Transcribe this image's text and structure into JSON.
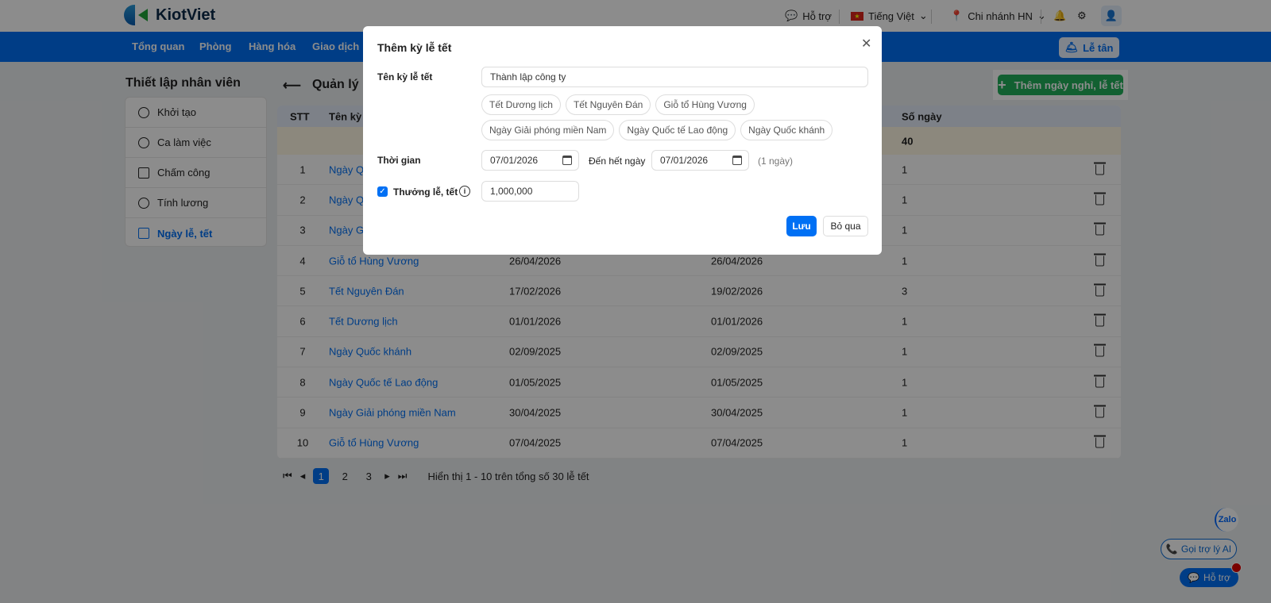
{
  "header": {
    "brand": "KiotViet",
    "support": "Hỗ trợ",
    "language": "Tiếng Việt",
    "branch": "Chi nhánh HN"
  },
  "nav": {
    "items": [
      "Tổng quan",
      "Phòng",
      "Hàng hóa",
      "Giao dịch"
    ],
    "reception": "Lễ tân"
  },
  "sidebar": {
    "title": "Thiết lập nhân viên",
    "items": [
      {
        "label": "Khởi tạo"
      },
      {
        "label": "Ca làm việc"
      },
      {
        "label": "Chấm công"
      },
      {
        "label": "Tính lương"
      },
      {
        "label": "Ngày lễ, tết"
      }
    ]
  },
  "main": {
    "title": "Quản lý Lễ",
    "add_button": "Thêm ngày nghỉ, lễ tết",
    "columns": {
      "stt": "STT",
      "name": "Tên kỳ lễ",
      "days": "Số ngày"
    },
    "total_days": "40",
    "rows": [
      {
        "stt": "1",
        "name": "Ngày Qu",
        "from": "",
        "to": "",
        "days": "1"
      },
      {
        "stt": "2",
        "name": "Ngày Qu",
        "from": "",
        "to": "",
        "days": "1"
      },
      {
        "stt": "3",
        "name": "Ngày Gi",
        "from": "",
        "to": "",
        "days": "1"
      },
      {
        "stt": "4",
        "name": "Giỗ tổ Hùng Vương",
        "from": "26/04/2026",
        "to": "26/04/2026",
        "days": "1"
      },
      {
        "stt": "5",
        "name": "Tết Nguyên Đán",
        "from": "17/02/2026",
        "to": "19/02/2026",
        "days": "3"
      },
      {
        "stt": "6",
        "name": "Tết Dương lịch",
        "from": "01/01/2026",
        "to": "01/01/2026",
        "days": "1"
      },
      {
        "stt": "7",
        "name": "Ngày Quốc khánh",
        "from": "02/09/2025",
        "to": "02/09/2025",
        "days": "1"
      },
      {
        "stt": "8",
        "name": "Ngày Quốc tế Lao động",
        "from": "01/05/2025",
        "to": "01/05/2025",
        "days": "1"
      },
      {
        "stt": "9",
        "name": "Ngày Giải phóng miền Nam",
        "from": "30/04/2025",
        "to": "30/04/2025",
        "days": "1"
      },
      {
        "stt": "10",
        "name": "Giỗ tổ Hùng Vương",
        "from": "07/04/2025",
        "to": "07/04/2025",
        "days": "1"
      }
    ],
    "pages": [
      "1",
      "2",
      "3"
    ],
    "page_info": "Hiển thị 1 - 10 trên tổng số 30 lễ tết"
  },
  "floating": {
    "zalo": "Zalo",
    "ai": "Gọi trợ lý AI",
    "help": "Hỗ trợ"
  },
  "modal": {
    "title": "Thêm kỳ lễ tết",
    "name_label": "Tên kỳ lễ tết",
    "name_value": "Thành lập công ty",
    "suggestions": [
      "Tết Dương lịch",
      "Tết Nguyên Đán",
      "Giỗ tổ Hùng Vương",
      "Ngày Giải phóng miền Nam",
      "Ngày Quốc tế Lao động",
      "Ngày Quốc khánh"
    ],
    "time_label": "Thời gian",
    "from": "07/01/2026",
    "to_label": "Đến hết ngày",
    "to": "07/01/2026",
    "duration": "(1 ngày)",
    "bonus_label": "Thưởng lễ, tết",
    "bonus_checked": true,
    "bonus_value": "1,000,000",
    "save": "Lưu",
    "cancel": "Bỏ qua"
  }
}
